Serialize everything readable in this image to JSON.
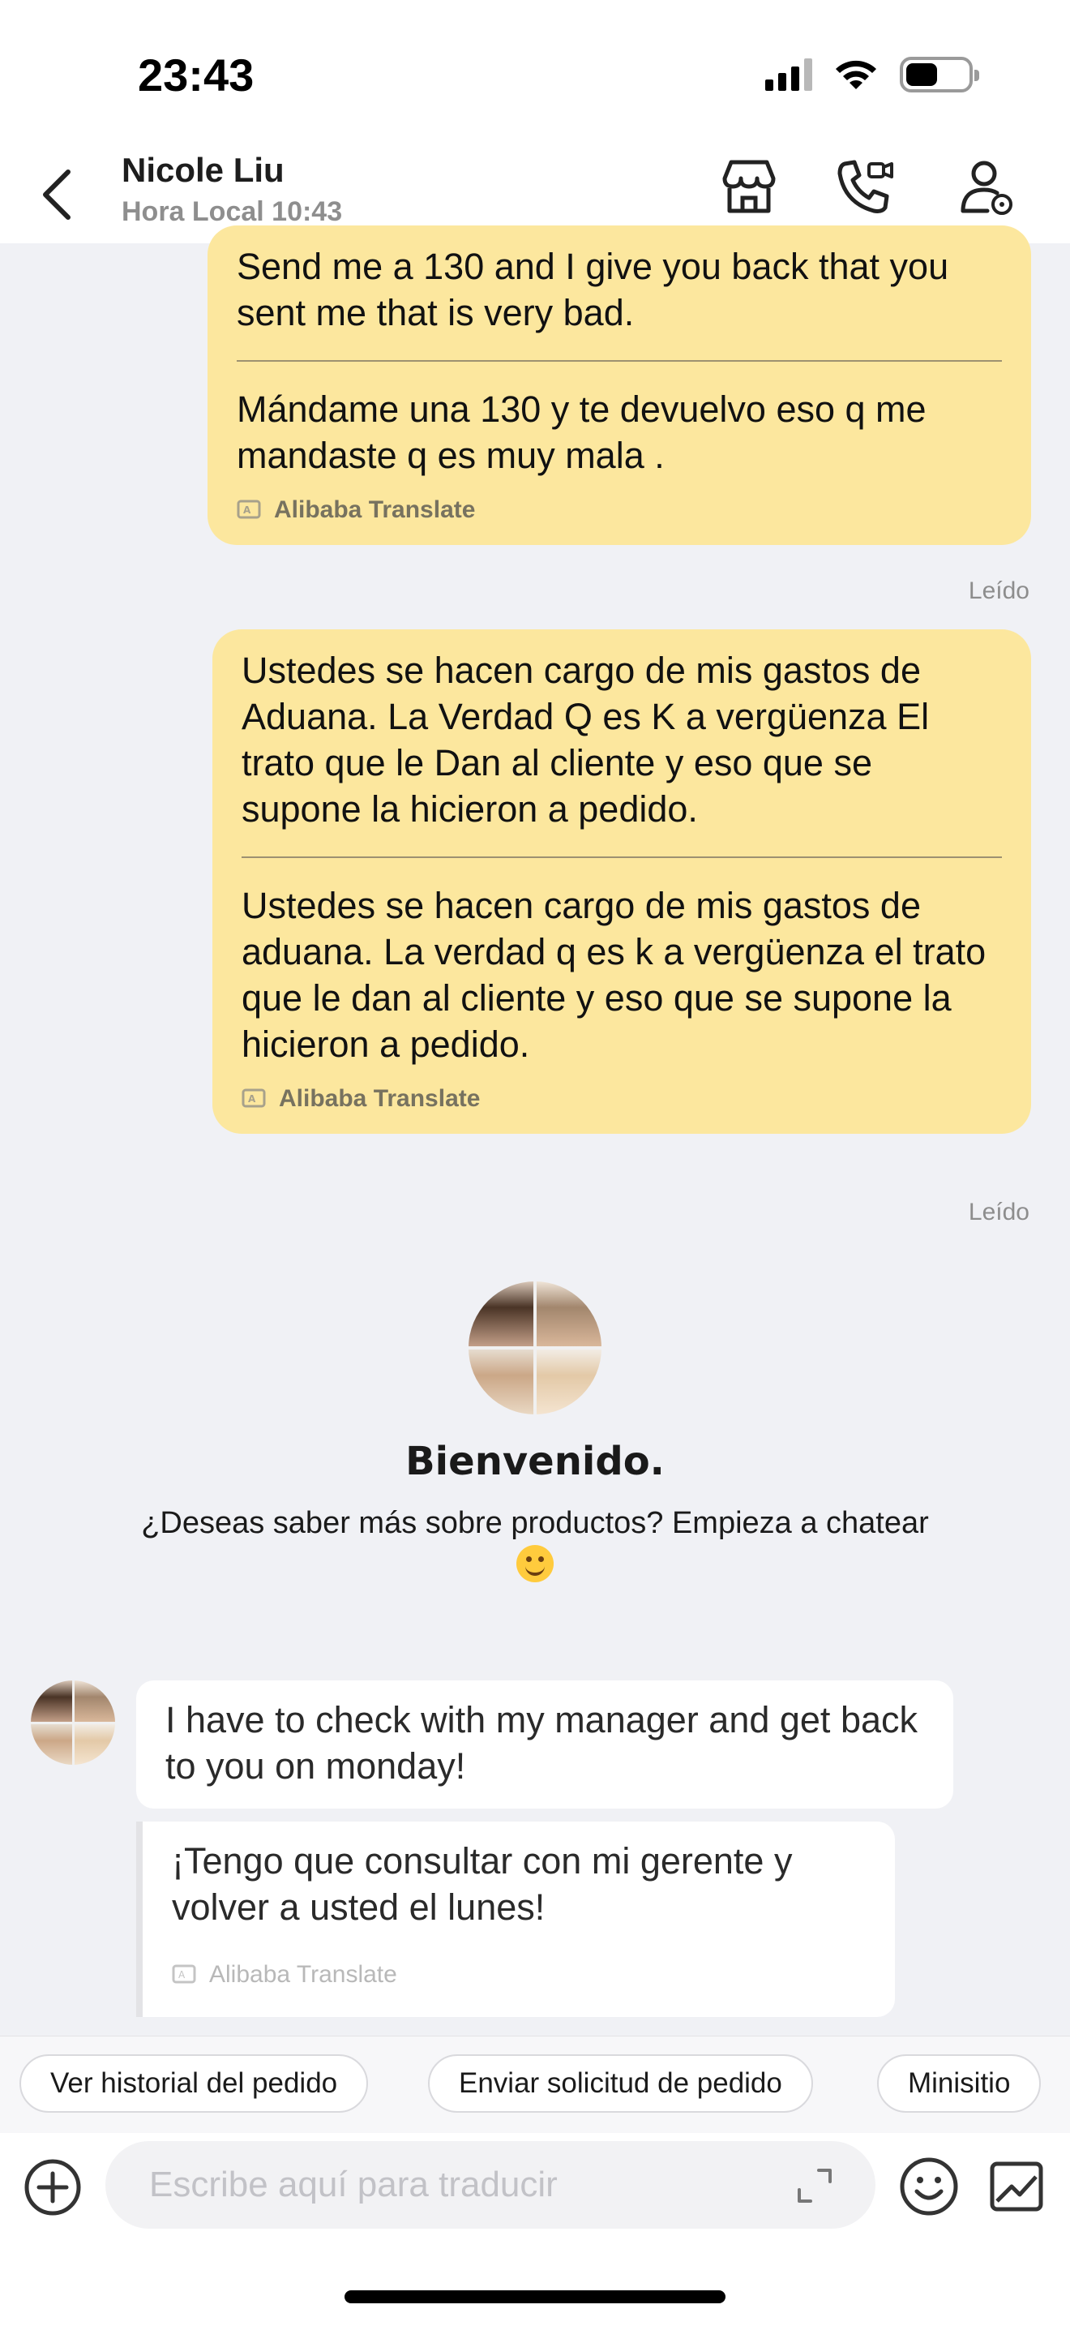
{
  "status_bar": {
    "time": "23:43",
    "icons": [
      "signal-icon",
      "wifi-icon",
      "battery-icon"
    ]
  },
  "header": {
    "contact_name": "Nicole Liu",
    "local_time": "Hora Local 10:43",
    "icons": [
      "back-icon",
      "store-icon",
      "video-call-icon",
      "contact-info-icon"
    ]
  },
  "messages": {
    "out1": {
      "translated": "Send me a 130 and I give you back that you sent me that is very bad.",
      "original": "Mándame una 130 y te devuelvo eso q me mandaste q es muy mala .",
      "translate_label": "Alibaba Translate",
      "status": "Leído"
    },
    "out2": {
      "original": "Ustedes se hacen cargo de mis gastos de Aduana. La Verdad Q es K a vergüenza El trato que le Dan al cliente y eso que se supone la hicieron a pedido.",
      "translated": "Ustedes se hacen cargo de mis gastos de aduana. La verdad q es k a vergüenza el trato que le dan al cliente y eso que se supone la hicieron a pedido.",
      "translate_label": "Alibaba Translate",
      "status": "Leído"
    },
    "welcome": {
      "title": "Bienvenido.",
      "subtitle": "¿Deseas saber más sobre productos? Empieza a chatear"
    },
    "in1": {
      "text": "I have to check with my manager  and get back to you on monday!",
      "translated": "¡Tengo que consultar con mi gerente y volver a usted el lunes!",
      "translate_label": "Alibaba Translate"
    }
  },
  "quick_actions": [
    "Ver historial del pedido",
    "Enviar solicitud de pedido",
    "Minisitio"
  ],
  "composer": {
    "placeholder": "Escribe aquí para traducir",
    "icons": [
      "add-icon",
      "expand-icon",
      "emoji-icon",
      "image-icon"
    ]
  },
  "colors": {
    "outgoing_bubble": "#fce79e",
    "incoming_bubble": "#ffffff",
    "chat_background": "#f0f1f5"
  }
}
